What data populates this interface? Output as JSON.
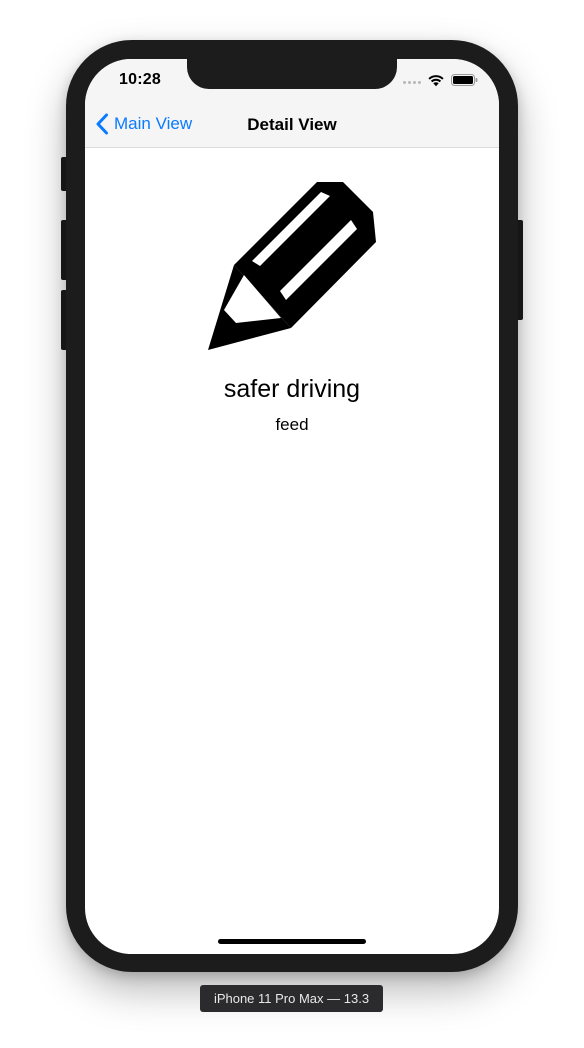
{
  "status_bar": {
    "time": "10:28"
  },
  "nav_bar": {
    "back_label": "Main View",
    "title": "Detail View"
  },
  "detail": {
    "icon": "pencil-icon",
    "title": "safer driving",
    "subtitle": "feed"
  },
  "device_label": "iPhone 11 Pro Max — 13.3",
  "colors": {
    "tint": "#0a7aff",
    "bar_background": "#f5f5f6",
    "bezel": "#1c1c1d"
  }
}
